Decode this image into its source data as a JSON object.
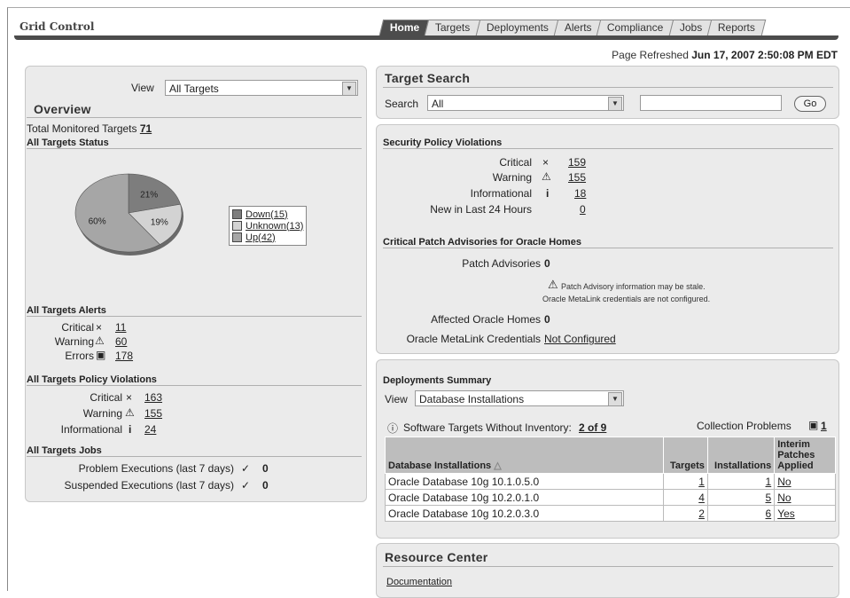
{
  "app": {
    "title": "Grid Control"
  },
  "tabs": [
    "Home",
    "Targets",
    "Deployments",
    "Alerts",
    "Compliance",
    "Jobs",
    "Reports"
  ],
  "refresh": {
    "label": "Page Refreshed",
    "time": "Jun 17, 2007 2:50:08 PM EDT"
  },
  "overview": {
    "view_label": "View",
    "view_value": "All Targets",
    "title": "Overview",
    "total_label": "Total Monitored Targets",
    "total_value": "71",
    "status_title": "All Targets Status",
    "pie": [
      {
        "label": "21%",
        "name": "Down(15)",
        "value": 15,
        "color": "#7d7d7d"
      },
      {
        "label": "19%",
        "name": "Unknown(13)",
        "value": 13,
        "color": "#d3d3d3"
      },
      {
        "label": "60%",
        "name": "Up(42)",
        "value": 42,
        "color": "#a6a6a6"
      }
    ],
    "alerts_title": "All Targets Alerts",
    "alerts": [
      {
        "label": "Critical",
        "icon": "×",
        "value": "11"
      },
      {
        "label": "Warning",
        "icon": "⚠",
        "value": "60"
      },
      {
        "label": "Errors",
        "icon": "▣",
        "value": "178"
      }
    ],
    "policy_title": "All Targets Policy Violations",
    "policy": [
      {
        "label": "Critical",
        "icon": "×",
        "value": "163"
      },
      {
        "label": "Warning",
        "icon": "⚠",
        "value": "155"
      },
      {
        "label": "Informational",
        "icon": "i",
        "value": "24"
      }
    ],
    "jobs_title": "All Targets Jobs",
    "jobs": [
      {
        "label": "Problem Executions (last 7 days)",
        "icon": "✓",
        "value": "0"
      },
      {
        "label": "Suspended Executions (last 7 days)",
        "icon": "✓",
        "value": "0"
      }
    ]
  },
  "target_search": {
    "title": "Target Search",
    "search_label": "Search",
    "search_value": "All",
    "go_label": "Go"
  },
  "security": {
    "title": "Security Policy Violations",
    "rows": [
      {
        "label": "Critical",
        "icon": "×",
        "value": "159"
      },
      {
        "label": "Warning",
        "icon": "⚠",
        "value": "155"
      },
      {
        "label": "Informational",
        "icon": "i",
        "value": "18"
      },
      {
        "label": "New in Last 24 Hours",
        "icon": "",
        "value": "0"
      }
    ],
    "patch_title": "Critical Patch Advisories for Oracle Homes",
    "patch_label": "Patch Advisories",
    "patch_value": "0",
    "note1": "Patch Advisory information may be stale.",
    "note2": "Oracle MetaLink credentials are not configured.",
    "affected_label": "Affected Oracle Homes",
    "affected_value": "0",
    "cred_label": "Oracle MetaLink Credentials",
    "cred_value": "Not Configured"
  },
  "deployments": {
    "title": "Deployments Summary",
    "view_label": "View",
    "view_value": "Database Installations",
    "inventory_label": "Software Targets Without Inventory:",
    "inventory_value": "2 of 9",
    "problems_label": "Collection Problems",
    "problems_value": "1",
    "columns": [
      "Database Installations",
      "Targets",
      "Installations",
      "Interim Patches Applied"
    ],
    "rows": [
      {
        "name": "Oracle Database 10g 10.1.0.5.0",
        "targets": "1",
        "installs": "1",
        "patches": "No"
      },
      {
        "name": "Oracle Database 10g 10.2.0.1.0",
        "targets": "4",
        "installs": "5",
        "patches": "No"
      },
      {
        "name": "Oracle Database 10g 10.2.0.3.0",
        "targets": "2",
        "installs": "6",
        "patches": "Yes"
      }
    ]
  },
  "resource": {
    "title": "Resource Center",
    "first_item": "Documentation"
  }
}
